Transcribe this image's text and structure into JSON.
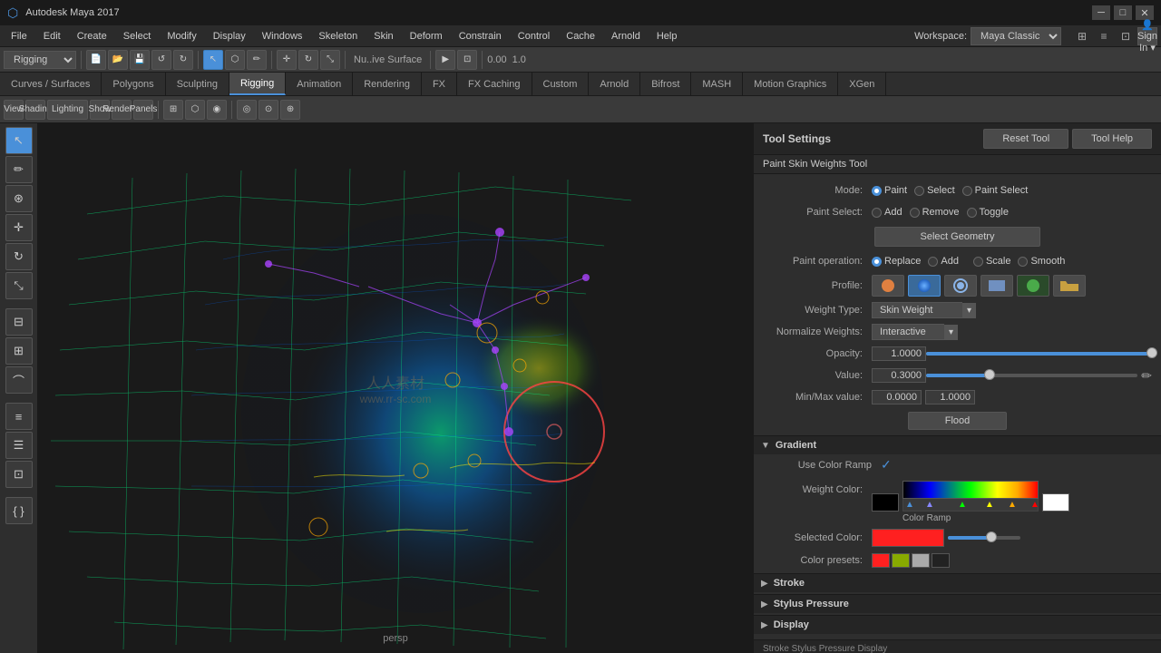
{
  "titlebar": {
    "title": "Autodesk Maya 2017",
    "minimize": "─",
    "maximize": "□",
    "close": "✕"
  },
  "menu": {
    "items": [
      "File",
      "Edit",
      "Create",
      "Select",
      "Modify",
      "Display",
      "Windows",
      "Skeleton",
      "Skin",
      "Deform",
      "Constrain",
      "Control",
      "Cache",
      "Arnold",
      "Help"
    ]
  },
  "workspace": {
    "label": "Workspace:",
    "value": "Maya Classic"
  },
  "tabs": [
    {
      "label": "Curves / Surfaces",
      "active": false
    },
    {
      "label": "Polygons",
      "active": false
    },
    {
      "label": "Sculpting",
      "active": false
    },
    {
      "label": "Rigging",
      "active": true
    },
    {
      "label": "Animation",
      "active": false
    },
    {
      "label": "Rendering",
      "active": false
    },
    {
      "label": "FX",
      "active": false
    },
    {
      "label": "FX Caching",
      "active": false
    },
    {
      "label": "Custom",
      "active": false
    },
    {
      "label": "Arnold",
      "active": false
    },
    {
      "label": "Bifrost",
      "active": false
    },
    {
      "label": "MASH",
      "active": false
    },
    {
      "label": "Motion Graphics",
      "active": false
    },
    {
      "label": "XGen",
      "active": false
    }
  ],
  "viewport": {
    "label": "persp",
    "watermark": "人人素材\nwww.rr-sc.com"
  },
  "tool_settings": {
    "header": "Tool Settings",
    "tool_name": "Paint Skin Weights Tool",
    "reset_btn": "Reset Tool",
    "help_btn": "Tool Help",
    "mode_label": "Mode:",
    "mode_options": [
      "Paint",
      "Select",
      "Paint Select"
    ],
    "mode_selected": "Paint",
    "paint_select_label": "Paint Select:",
    "paint_select_options": [
      "Add",
      "Remove",
      "Toggle"
    ],
    "paint_select_selected": "Add",
    "select_geometry_btn": "Select Geometry",
    "paint_operation_label": "Paint operation:",
    "paint_operations": [
      {
        "label": "Replace",
        "selected": true
      },
      {
        "label": "Add",
        "selected": false
      },
      {
        "label": "Scale",
        "selected": false
      },
      {
        "label": "Smooth",
        "selected": false
      }
    ],
    "profile_label": "Profile:",
    "weight_type_label": "Weight Type:",
    "weight_type_value": "Skin Weight",
    "normalize_label": "Normalize Weights:",
    "normalize_value": "Interactive",
    "opacity_label": "Opacity:",
    "opacity_value": "1.0000",
    "opacity_pct": 100,
    "value_label": "Value:",
    "value_value": "0.3000",
    "value_pct": 30,
    "minmax_label": "Min/Max value:",
    "min_value": "0.0000",
    "max_value": "1.0000",
    "flood_btn": "Flood",
    "gradient_section": "Gradient",
    "use_color_ramp_label": "Use Color Ramp",
    "use_color_ramp_checked": true,
    "weight_color_label": "Weight Color:",
    "selected_color_label": "Selected Color:",
    "color_presets_label": "Color presets:",
    "stroke_section": "Stroke",
    "stylus_section": "Stylus Pressure",
    "display_section": "Display",
    "bottom_text": "Stroke Stylus Pressure Display"
  }
}
